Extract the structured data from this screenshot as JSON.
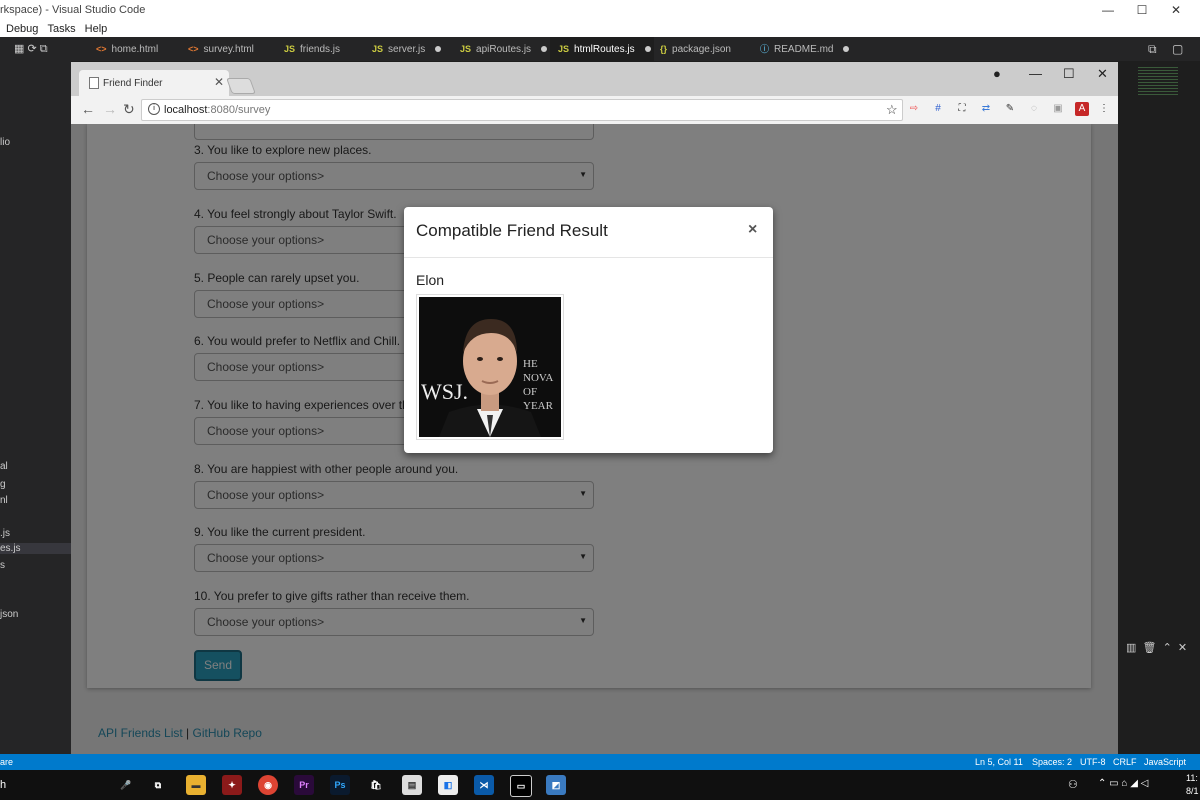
{
  "vscode": {
    "title": "rkspace) - Visual Studio Code",
    "menu": [
      "Debug",
      "Tasks",
      "Help"
    ],
    "tabs": [
      {
        "icon": "<>",
        "label": "home.html",
        "modified": false,
        "active": false
      },
      {
        "icon": "<>",
        "label": "survey.html",
        "modified": false,
        "active": false
      },
      {
        "icon": "JS",
        "label": "friends.js",
        "modified": false,
        "active": false
      },
      {
        "icon": "JS",
        "label": "server.js",
        "modified": true,
        "active": false
      },
      {
        "icon": "JS",
        "label": "apiRoutes.js",
        "modified": true,
        "active": false
      },
      {
        "icon": "JS",
        "label": "htmlRoutes.js",
        "modified": true,
        "active": true
      },
      {
        "icon": "{}",
        "label": "package.json",
        "modified": false,
        "active": false
      },
      {
        "icon": "ⓘ",
        "label": "README.md",
        "modified": true,
        "active": false
      }
    ],
    "sidebar_fragments": [
      "lio",
      "al",
      "g",
      "nl",
      ".js",
      "es.js",
      "s",
      "json"
    ],
    "status": {
      "left": "are",
      "position": "Ln 5, Col 11",
      "spaces": "Spaces: 2",
      "encoding": "UTF-8",
      "eol": "CRLF",
      "language": "JavaScript"
    }
  },
  "chrome": {
    "tab_title": "Friend Finder",
    "url_host": "localhost",
    "url_rest": ":8080/survey"
  },
  "survey": {
    "questions": [
      {
        "label": "3. You like to explore new places.",
        "placeholder": "Choose your options>"
      },
      {
        "label": "4. You feel strongly about Taylor Swift.",
        "placeholder": "Choose your options>"
      },
      {
        "label": "5. People can rarely upset you.",
        "placeholder": "Choose your options>"
      },
      {
        "label": "6. You would prefer to Netflix and Chill.",
        "placeholder": "Choose your options>"
      },
      {
        "label": "7. You like to having experiences over things.",
        "placeholder": "Choose your options>"
      },
      {
        "label": "8. You are happiest with other people around you.",
        "placeholder": "Choose your options>"
      },
      {
        "label": "9. You like the current president.",
        "placeholder": "Choose your options>"
      },
      {
        "label": "10. You prefer to give gifts rather than receive them.",
        "placeholder": "Choose your options>"
      }
    ],
    "send_label": "Send",
    "footer": {
      "api_link": "API Friends List",
      "separator": "|",
      "github_link": "GitHub Repo"
    }
  },
  "modal": {
    "title": "Compatible Friend Result",
    "close": "×",
    "friend_name": "Elon",
    "photo_text": "WSJ."
  },
  "taskbar": {
    "search_fragment": "h",
    "clock": "11:",
    "date": "8/1"
  }
}
